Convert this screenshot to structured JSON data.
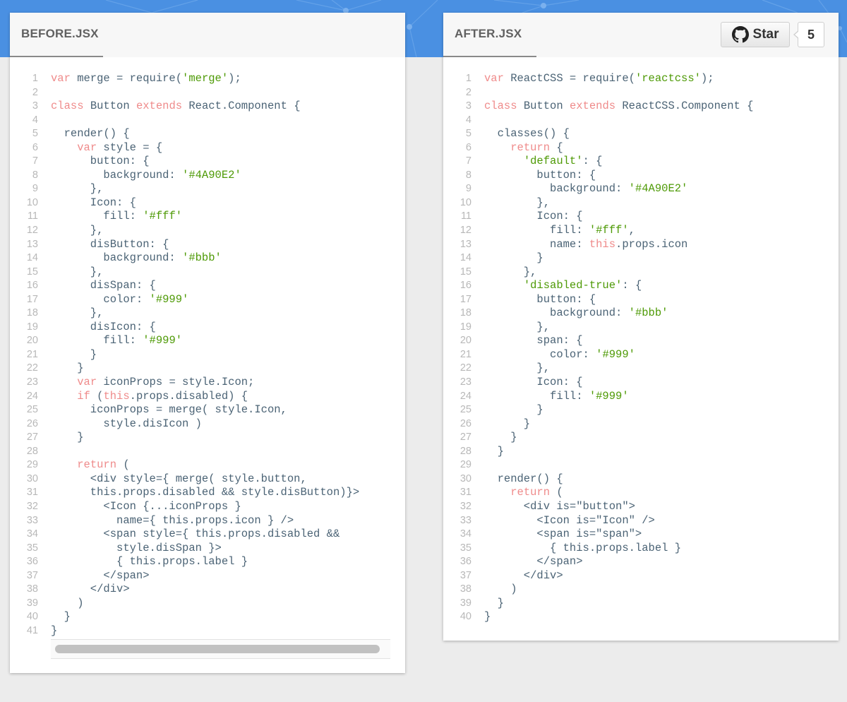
{
  "theme": {
    "hero_bg": "#4A90E2",
    "page_bg": "#ECECEC",
    "keyword_color": "#EF8B8B",
    "string_color": "#4E9A06",
    "code_color": "#4B6375",
    "line_number_color": "#B8B8B8"
  },
  "before": {
    "title": "BEFORE.JSX",
    "lines": [
      [
        [
          "kw",
          "var"
        ],
        [
          "t",
          " merge = require("
        ],
        [
          "str",
          "'merge'"
        ],
        [
          "t",
          ");"
        ]
      ],
      [],
      [
        [
          "kw",
          "class"
        ],
        [
          "t",
          " Button "
        ],
        [
          "kw",
          "extends"
        ],
        [
          "t",
          " React.Component {"
        ]
      ],
      [],
      [
        [
          "t",
          "  render() {"
        ]
      ],
      [
        [
          "t",
          "    "
        ],
        [
          "kw",
          "var"
        ],
        [
          "t",
          " style = {"
        ]
      ],
      [
        [
          "t",
          "      button: {"
        ]
      ],
      [
        [
          "t",
          "        background: "
        ],
        [
          "str",
          "'#4A90E2'"
        ]
      ],
      [
        [
          "t",
          "      },"
        ]
      ],
      [
        [
          "t",
          "      Icon: {"
        ]
      ],
      [
        [
          "t",
          "        fill: "
        ],
        [
          "str",
          "'#fff'"
        ]
      ],
      [
        [
          "t",
          "      },"
        ]
      ],
      [
        [
          "t",
          "      disButton: {"
        ]
      ],
      [
        [
          "t",
          "        background: "
        ],
        [
          "str",
          "'#bbb'"
        ]
      ],
      [
        [
          "t",
          "      },"
        ]
      ],
      [
        [
          "t",
          "      disSpan: {"
        ]
      ],
      [
        [
          "t",
          "        color: "
        ],
        [
          "str",
          "'#999'"
        ]
      ],
      [
        [
          "t",
          "      },"
        ]
      ],
      [
        [
          "t",
          "      disIcon: {"
        ]
      ],
      [
        [
          "t",
          "        fill: "
        ],
        [
          "str",
          "'#999'"
        ]
      ],
      [
        [
          "t",
          "      }"
        ]
      ],
      [
        [
          "t",
          "    }"
        ]
      ],
      [
        [
          "t",
          "    "
        ],
        [
          "kw",
          "var"
        ],
        [
          "t",
          " iconProps = style.Icon;"
        ]
      ],
      [
        [
          "t",
          "    "
        ],
        [
          "kw",
          "if"
        ],
        [
          "t",
          " ("
        ],
        [
          "kw",
          "this"
        ],
        [
          "t",
          ".props.disabled) {"
        ]
      ],
      [
        [
          "t",
          "      iconProps = merge( style.Icon,"
        ]
      ],
      [
        [
          "t",
          "        style.disIcon )"
        ]
      ],
      [
        [
          "t",
          "    }"
        ]
      ],
      [],
      [
        [
          "t",
          "    "
        ],
        [
          "kw",
          "return"
        ],
        [
          "t",
          " ("
        ]
      ],
      [
        [
          "t",
          "      <div style={ merge( style.button,"
        ]
      ],
      [
        [
          "t",
          "      this.props.disabled && style.disButton)}>"
        ]
      ],
      [
        [
          "t",
          "        <Icon {...iconProps }"
        ]
      ],
      [
        [
          "t",
          "          name={ this.props.icon } />"
        ]
      ],
      [
        [
          "t",
          "        <span style={ this.props.disabled &&"
        ]
      ],
      [
        [
          "t",
          "          style.disSpan }>"
        ]
      ],
      [
        [
          "t",
          "          { this.props.label }"
        ]
      ],
      [
        [
          "t",
          "        </span>"
        ]
      ],
      [
        [
          "t",
          "      </div>"
        ]
      ],
      [
        [
          "t",
          "    )"
        ]
      ],
      [
        [
          "t",
          "  }"
        ]
      ],
      [
        [
          "t",
          "}"
        ]
      ]
    ]
  },
  "after": {
    "title": "AFTER.JSX",
    "star_label": "Star",
    "star_count": "5",
    "lines": [
      [
        [
          "kw",
          "var"
        ],
        [
          "t",
          " ReactCSS = require("
        ],
        [
          "str",
          "'reactcss'"
        ],
        [
          "t",
          ");"
        ]
      ],
      [],
      [
        [
          "kw",
          "class"
        ],
        [
          "t",
          " Button "
        ],
        [
          "kw",
          "extends"
        ],
        [
          "t",
          " ReactCSS.Component {"
        ]
      ],
      [],
      [
        [
          "t",
          "  classes() {"
        ]
      ],
      [
        [
          "t",
          "    "
        ],
        [
          "kw",
          "return"
        ],
        [
          "t",
          " {"
        ]
      ],
      [
        [
          "t",
          "      "
        ],
        [
          "str",
          "'default'"
        ],
        [
          "t",
          ": {"
        ]
      ],
      [
        [
          "t",
          "        button: {"
        ]
      ],
      [
        [
          "t",
          "          background: "
        ],
        [
          "str",
          "'#4A90E2'"
        ]
      ],
      [
        [
          "t",
          "        },"
        ]
      ],
      [
        [
          "t",
          "        Icon: {"
        ]
      ],
      [
        [
          "t",
          "          fill: "
        ],
        [
          "str",
          "'#fff'"
        ],
        [
          "t",
          ","
        ]
      ],
      [
        [
          "t",
          "          name: "
        ],
        [
          "kw",
          "this"
        ],
        [
          "t",
          ".props.icon"
        ]
      ],
      [
        [
          "t",
          "        }"
        ]
      ],
      [
        [
          "t",
          "      },"
        ]
      ],
      [
        [
          "t",
          "      "
        ],
        [
          "str",
          "'disabled-true'"
        ],
        [
          "t",
          ": {"
        ]
      ],
      [
        [
          "t",
          "        button: {"
        ]
      ],
      [
        [
          "t",
          "          background: "
        ],
        [
          "str",
          "'#bbb'"
        ]
      ],
      [
        [
          "t",
          "        },"
        ]
      ],
      [
        [
          "t",
          "        span: {"
        ]
      ],
      [
        [
          "t",
          "          color: "
        ],
        [
          "str",
          "'#999'"
        ]
      ],
      [
        [
          "t",
          "        },"
        ]
      ],
      [
        [
          "t",
          "        Icon: {"
        ]
      ],
      [
        [
          "t",
          "          fill: "
        ],
        [
          "str",
          "'#999'"
        ]
      ],
      [
        [
          "t",
          "        }"
        ]
      ],
      [
        [
          "t",
          "      }"
        ]
      ],
      [
        [
          "t",
          "    }"
        ]
      ],
      [
        [
          "t",
          "  }"
        ]
      ],
      [],
      [
        [
          "t",
          "  render() {"
        ]
      ],
      [
        [
          "t",
          "    "
        ],
        [
          "kw",
          "return"
        ],
        [
          "t",
          " ("
        ]
      ],
      [
        [
          "t",
          "      <div is=\"button\">"
        ]
      ],
      [
        [
          "t",
          "        <Icon is=\"Icon\" />"
        ]
      ],
      [
        [
          "t",
          "        <span is=\"span\">"
        ]
      ],
      [
        [
          "t",
          "          { this.props.label }"
        ]
      ],
      [
        [
          "t",
          "        </span>"
        ]
      ],
      [
        [
          "t",
          "      </div>"
        ]
      ],
      [
        [
          "t",
          "    )"
        ]
      ],
      [
        [
          "t",
          "  }"
        ]
      ],
      [
        [
          "t",
          "}"
        ]
      ]
    ]
  }
}
